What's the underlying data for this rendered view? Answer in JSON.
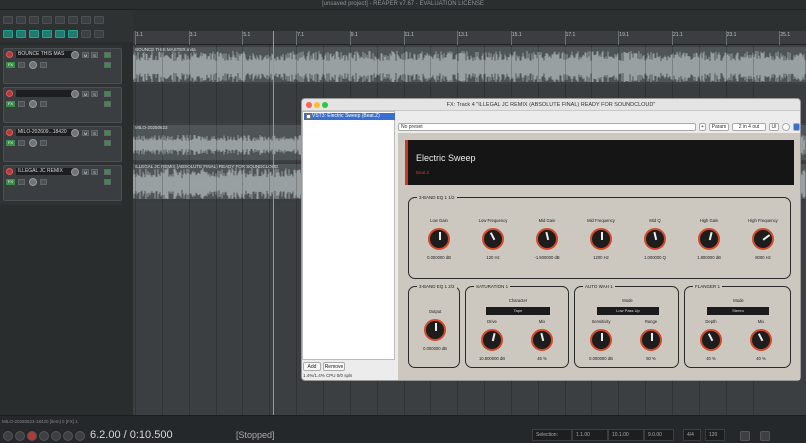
{
  "window": {
    "title": "[unsaved project] - REAPER v7.67 - EVALUATION LICENSE"
  },
  "ruler": {
    "marks": [
      {
        "bar": "1.1",
        "time": "0:00.000"
      },
      {
        "bar": "3.1",
        "time": "0:04.000"
      },
      {
        "bar": "5.1",
        "time": "0:08.000"
      },
      {
        "bar": "7.1",
        "time": "0:12.000"
      },
      {
        "bar": "9.1",
        "time": "0:16.000"
      },
      {
        "bar": "11.1",
        "time": "0:20.000"
      },
      {
        "bar": "13.1",
        "time": "0:24.000"
      },
      {
        "bar": "15.1",
        "time": "0:28.000"
      },
      {
        "bar": "17.1",
        "time": "0:32.000"
      },
      {
        "bar": "19.1",
        "time": "0:36.000"
      },
      {
        "bar": "21.1",
        "time": "0:40.000"
      },
      {
        "bar": "23.1",
        "time": "0:44.000"
      },
      {
        "bar": "25.1",
        "time": "0:48.000"
      }
    ]
  },
  "tracks": [
    {
      "name": "BOUNCE THIS MAS",
      "item": "BOUNCE THIS MASTER.m4a"
    },
    {
      "name": "",
      "item": ""
    },
    {
      "name": "MILO-202609...18420",
      "item": "MILO-20250623"
    },
    {
      "name": "ILLEGAL JC REMIX",
      "item": "ILLEGAL JC REMIX (ABSOLUTE FINAL) READY FOR SOUNDCLOUD"
    }
  ],
  "fx": {
    "window_title": "FX: Track 4 \"ILLEGAL JC REMIX (ABSOLUTE FINAL) READY FOR SOUNDCLOUD\"",
    "chain": [
      {
        "name": "VST3: Electric Sweep (Beat.Z)"
      }
    ],
    "add_label": "Add",
    "remove_label": "Remove",
    "cpu": "1.4%/1.4% CPU 0/0 spls",
    "preset": "No preset",
    "plus": "+",
    "param": "Param",
    "io": "2 in 4 out",
    "ui": "UI"
  },
  "plugin": {
    "name": "Electric Sweep",
    "vendor": "Beat.Z",
    "eq_panel_title": "3-BAND EQ 1 1/2",
    "eq_knobs": [
      {
        "label": "Low Gain",
        "value": "0.000000 dB",
        "level": 0.5
      },
      {
        "label": "Low Frequency",
        "value": "120 Hz",
        "level": 0.4
      },
      {
        "label": "Mid Gain",
        "value": "-1.500000 dB",
        "level": 0.45
      },
      {
        "label": "Mid Frequency",
        "value": "1200 Hz",
        "level": 0.5
      },
      {
        "label": "Mid Q",
        "value": "1.000000 Q",
        "level": 0.45
      },
      {
        "label": "High Gain",
        "value": "1.800000 dB",
        "level": 0.55
      },
      {
        "label": "High Frequency",
        "value": "8000 Hz",
        "level": 0.7
      }
    ],
    "eq2": {
      "title": "3-BAND EQ 1 2/2",
      "knob": {
        "label": "Output",
        "value": "0.000000 dB",
        "level": 0.5
      }
    },
    "saturation": {
      "title": "SATURATION 1",
      "char_label": "Character",
      "char_value": "Tape",
      "knobs": [
        {
          "label": "Drive",
          "value": "10.800000 dB",
          "level": 0.55
        },
        {
          "label": "Mix",
          "value": "45 %",
          "level": 0.45
        }
      ]
    },
    "autowah": {
      "title": "AUTO WAH 1",
      "mode_label": "Mode",
      "mode_value": "Low Pass Up",
      "knobs": [
        {
          "label": "Sensitivity",
          "value": "0.000000 dB",
          "level": 0.5
        },
        {
          "label": "Range",
          "value": "50 %",
          "level": 0.5
        }
      ]
    },
    "flanger": {
      "title": "FLANGER 1",
      "mode_label": "Mode",
      "mode_value": "Stereo",
      "knobs": [
        {
          "label": "Depth",
          "value": "40 %",
          "level": 0.4
        },
        {
          "label": "Mix",
          "value": "40 %",
          "level": 0.4
        }
      ]
    }
  },
  "transport": {
    "status": "MILO-20250623-18420 [item] 0 [FX] 1",
    "time": "6.2.00 / 0:10.500",
    "state": "[Stopped]",
    "selection_label": "Selection:",
    "sel_start": "1.1.00",
    "sel_end": "10.1.00",
    "sel_len": "9.0.00",
    "timesig": "4/4",
    "bpm": "120"
  }
}
